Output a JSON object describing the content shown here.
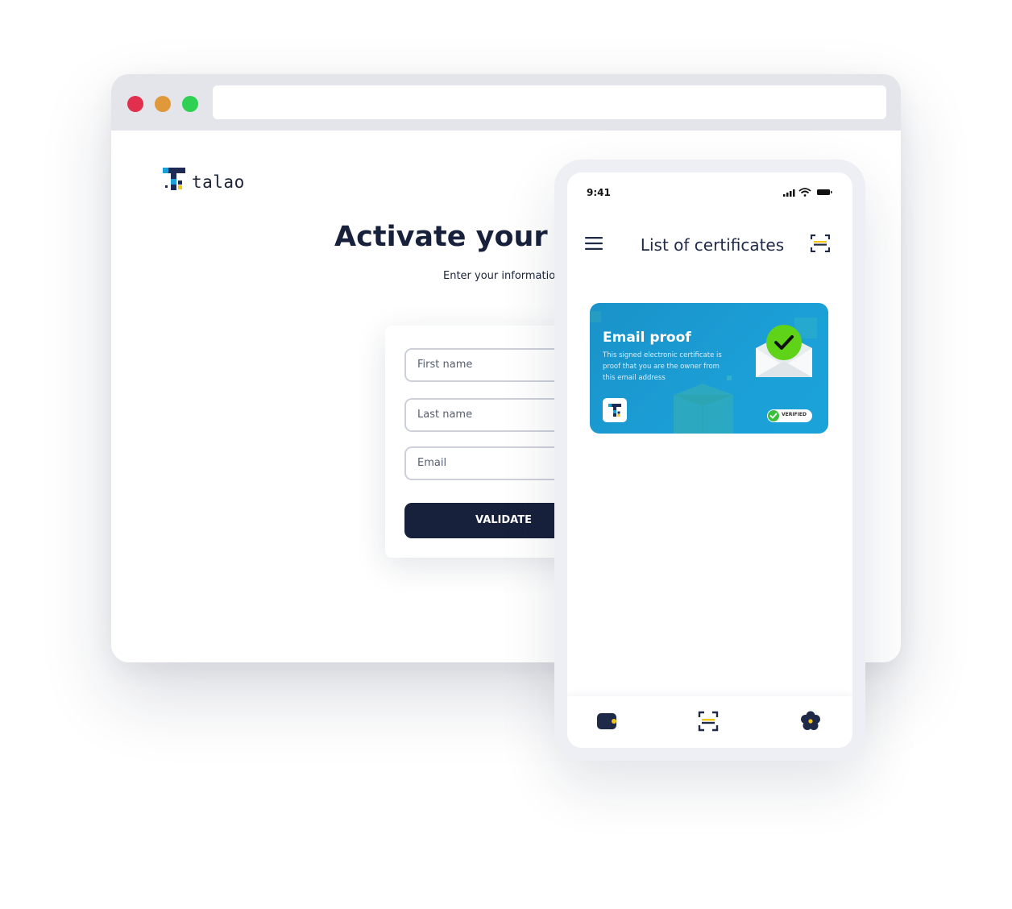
{
  "browser": {
    "url": ""
  },
  "page": {
    "logo_text": "talao",
    "title": "Activate your en",
    "subtitle": "Enter your information"
  },
  "form": {
    "first_name_placeholder": "First name",
    "last_name_placeholder": "Last name",
    "email_placeholder": "Email",
    "validate_label": "VALIDATE"
  },
  "phone": {
    "status_time": "9:41",
    "title": "List of certificates",
    "certificate": {
      "title": "Email proof",
      "description": "This signed electronic certificate is proof that you are the owner from this email address",
      "badge": "VERIFIED"
    },
    "nav": [
      "wallet-icon",
      "scan-icon",
      "settings-icon"
    ]
  },
  "colors": {
    "navy": "#18213c",
    "accent_yellow": "#f6c516",
    "card_blue": "#1b9fd6",
    "check_green": "#5fd318"
  }
}
